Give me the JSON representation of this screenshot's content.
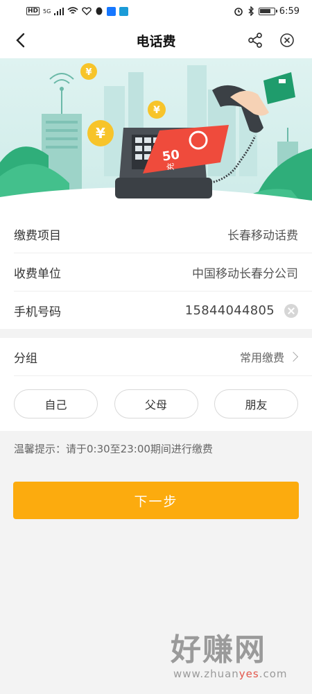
{
  "status_bar": {
    "hd": "HD",
    "network": "5G",
    "time": "6:59"
  },
  "header": {
    "title": "电话费"
  },
  "info": {
    "rows": [
      {
        "label": "缴费项目",
        "value": "长春移动话费"
      },
      {
        "label": "收费单位",
        "value": "中国移动长春分公司"
      }
    ],
    "phone_label": "手机号码",
    "phone_value": "15844044805"
  },
  "group": {
    "label": "分组",
    "value": "常用缴费",
    "chips": [
      "自己",
      "父母",
      "朋友"
    ]
  },
  "tip": "温馨提示：请于0:30至23:00期间进行缴费",
  "next_button": "下一步",
  "watermark": {
    "title": "好赚网",
    "url_prefix": "www.zhuan",
    "url_highlight": "yes",
    "url_suffix": ".com"
  },
  "banner": {
    "bill_amount": "50",
    "bill_char": "充"
  },
  "colors": {
    "accent": "#fcab0e",
    "banner_bg": "#dff3f1",
    "bill_red": "#ef4b3c"
  },
  "icons": [
    "back-arrow-icon",
    "share-icon",
    "close-icon",
    "clear-icon",
    "chevron-right-icon",
    "wifi-icon",
    "bluetooth-icon",
    "alarm-icon",
    "battery-icon"
  ]
}
